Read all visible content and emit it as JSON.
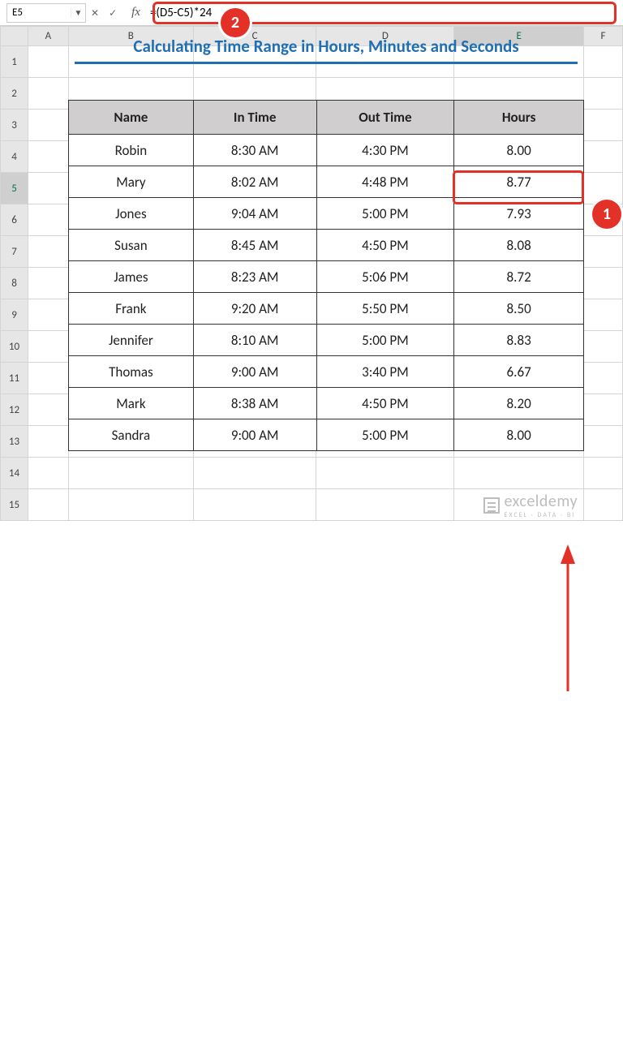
{
  "namebox": {
    "value": "E5"
  },
  "formula_bar": {
    "value": "=(D5-C5)*24"
  },
  "icon_labels": {
    "dropdown": "▼",
    "cancel": "✕",
    "confirm": "✓"
  },
  "columns": [
    "A",
    "B",
    "C",
    "D",
    "E",
    "F"
  ],
  "rows": [
    "1",
    "2",
    "3",
    "4",
    "5",
    "6",
    "7",
    "8",
    "9",
    "10",
    "11",
    "12",
    "13",
    "14",
    "15"
  ],
  "title": "Calculating Time Range in Hours, Minutes and Seconds",
  "table": {
    "headers": [
      "Name",
      "In Time",
      "Out Time",
      "Hours"
    ],
    "data": [
      [
        "Robin",
        "8:30 AM",
        "4:30 PM",
        "8.00"
      ],
      [
        "Mary",
        "8:02 AM",
        "4:48 PM",
        "8.77"
      ],
      [
        "Jones",
        "9:04 AM",
        "5:00 PM",
        "7.93"
      ],
      [
        "Susan",
        "8:45 AM",
        "4:50 PM",
        "8.08"
      ],
      [
        "James",
        "8:23 AM",
        "5:06 PM",
        "8.72"
      ],
      [
        "Frank",
        "9:20 AM",
        "5:50 PM",
        "8.50"
      ],
      [
        "Jennifer",
        "8:10 AM",
        "5:00 PM",
        "8.83"
      ],
      [
        "Thomas",
        "9:00 AM",
        "3:40 PM",
        "6.67"
      ],
      [
        "Mark",
        "8:38 AM",
        "4:50 PM",
        "8.20"
      ],
      [
        "Sandra",
        "9:00 AM",
        "5:00 PM",
        "8.00"
      ]
    ]
  },
  "callouts": {
    "one": "1",
    "two": "2"
  },
  "watermark": {
    "main": "exceldemy",
    "sub": "EXCEL · DATA · BI"
  },
  "col_widths": {
    "A": 50,
    "B": 154,
    "C": 152,
    "D": 170,
    "E": 160,
    "F": 48
  },
  "selected_col": "E",
  "selected_row": "5"
}
